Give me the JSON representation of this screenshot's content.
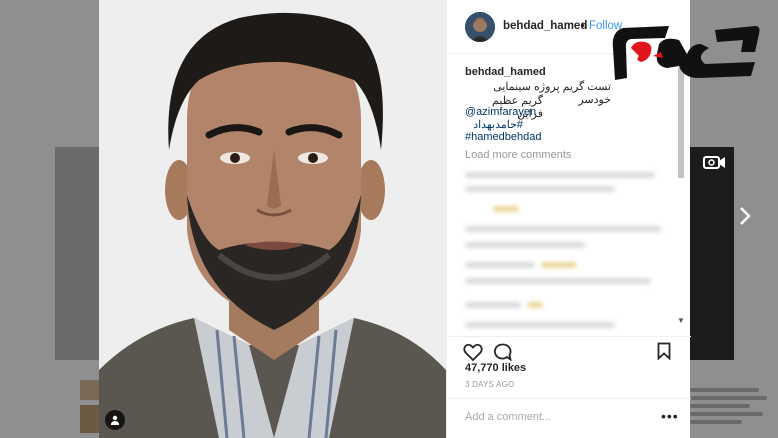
{
  "post": {
    "username": "behdad_hamed",
    "follow_label": "Follow",
    "separator": "•",
    "caption_username": "behdad_hamed",
    "caption_dot": ".",
    "caption_line1": "تست گریم پروژه سینمایی خودسر",
    "caption_line2": "گریم عظیم فراین",
    "mention": "@azimfarayen",
    "hashtag1": "#حامدبهداد",
    "hashtag2": "#hamedbehdad",
    "load_more": "Load more comments",
    "likes": "47,770 likes",
    "time": "3 DAYS AGO",
    "comment_placeholder": "Add a comment...",
    "more_options": "•••"
  },
  "icons": {
    "heart": "heart-icon",
    "comment": "comment-icon",
    "bookmark": "bookmark-icon",
    "tag": "user-tag-icon",
    "next": "chevron-right-icon",
    "video": "video-camera-icon"
  },
  "colors": {
    "link": "#3897f0",
    "logo_red": "#e1161c",
    "logo_black": "#111111"
  }
}
